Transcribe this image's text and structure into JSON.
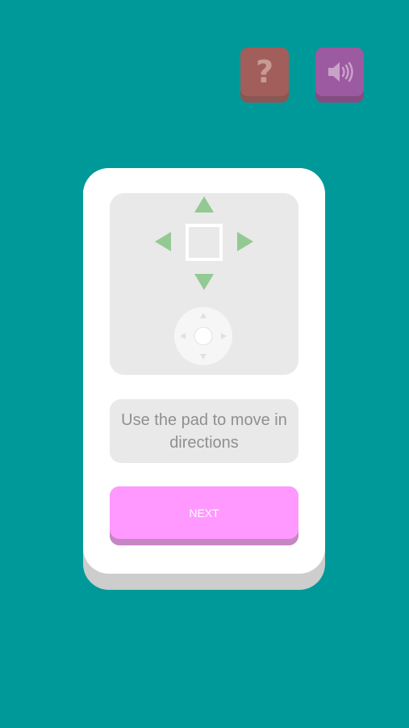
{
  "toolbar": {
    "help_label": "?",
    "help_icon": "question-icon",
    "sound_icon": "speaker-icon"
  },
  "tutorial": {
    "demo_icons": [
      "arrow-up-icon",
      "arrow-down-icon",
      "arrow-left-icon",
      "arrow-right-icon",
      "player-square-icon",
      "dpad-icon"
    ],
    "instruction_text": "Use the pad to move in directions",
    "next_label": "NEXT"
  },
  "colors": {
    "background": "#009999",
    "help_button": "#a25e5a",
    "sound_button": "#9c5aa0",
    "arrow": "#93c993",
    "next_button": "#ff99ff"
  }
}
